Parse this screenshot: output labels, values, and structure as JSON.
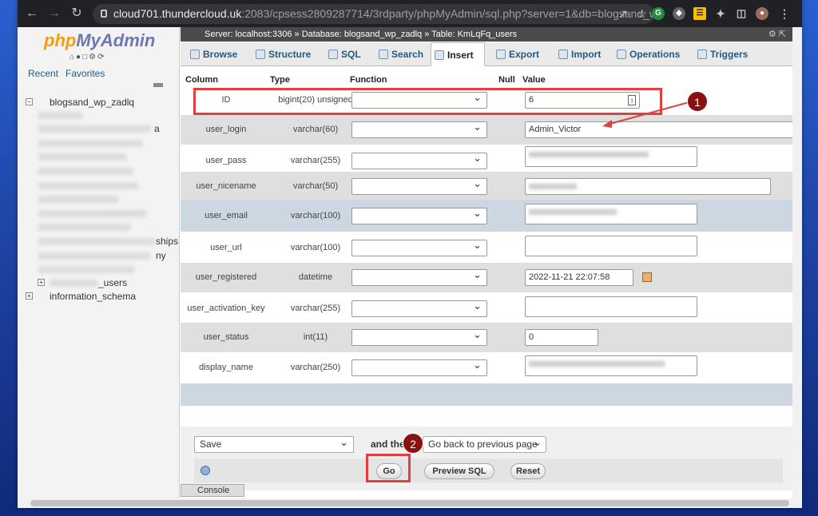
{
  "browser": {
    "url_host": "cloud701.thundercloud.uk",
    "url_path": ":2083/cpsess2809287714/3rdparty/phpMyAdmin/sql.php?server=1&db=blogsand_wp_z..."
  },
  "sidebar": {
    "logo_php": "php",
    "logo_myadmin": "MyAdmin",
    "recent": "Recent",
    "favorites": "Favorites",
    "db_name": "blogsand_wp_zadlq",
    "partial_a": "a",
    "partial_ships": "ships",
    "partial_ny": "ny",
    "users_item": "_users",
    "info_schema": "information_schema"
  },
  "breadcrumb": {
    "server": "Server: localhost:3306",
    "database": "Database: blogsand_wp_zadlq",
    "table": "Table: KmLqFq_users"
  },
  "tabs": [
    "Browse",
    "Structure",
    "SQL",
    "Search",
    "Insert",
    "Export",
    "Import",
    "Operations",
    "Triggers"
  ],
  "active_tab": "Insert",
  "columns": {
    "column": "Column",
    "type": "Type",
    "function": "Function",
    "null": "Null",
    "value": "Value"
  },
  "rows": [
    {
      "name": "ID",
      "type": "bigint(20) unsigned",
      "value": "6"
    },
    {
      "name": "user_login",
      "type": "varchar(60)",
      "value": "Admin_Victor"
    },
    {
      "name": "user_pass",
      "type": "varchar(255)",
      "value": ""
    },
    {
      "name": "user_nicename",
      "type": "varchar(50)",
      "value": ""
    },
    {
      "name": "user_email",
      "type": "varchar(100)",
      "value": ""
    },
    {
      "name": "user_url",
      "type": "varchar(100)",
      "value": ""
    },
    {
      "name": "user_registered",
      "type": "datetime",
      "value": "2022-11-21 22:07:58"
    },
    {
      "name": "user_activation_key",
      "type": "varchar(255)",
      "value": ""
    },
    {
      "name": "user_status",
      "type": "int(11)",
      "value": "0"
    },
    {
      "name": "display_name",
      "type": "varchar(250)",
      "value": ""
    }
  ],
  "footer": {
    "save_option": "Save",
    "and_then": "and then",
    "after_option": "Go back to previous page",
    "go": "Go",
    "preview_sql": "Preview SQL",
    "reset": "Reset",
    "console": "Console"
  },
  "annotations": {
    "badge1": "1",
    "badge2": "2"
  },
  "colors": {
    "highlight": "#e04040",
    "badge": "#8b1010",
    "link": "#235a81"
  }
}
